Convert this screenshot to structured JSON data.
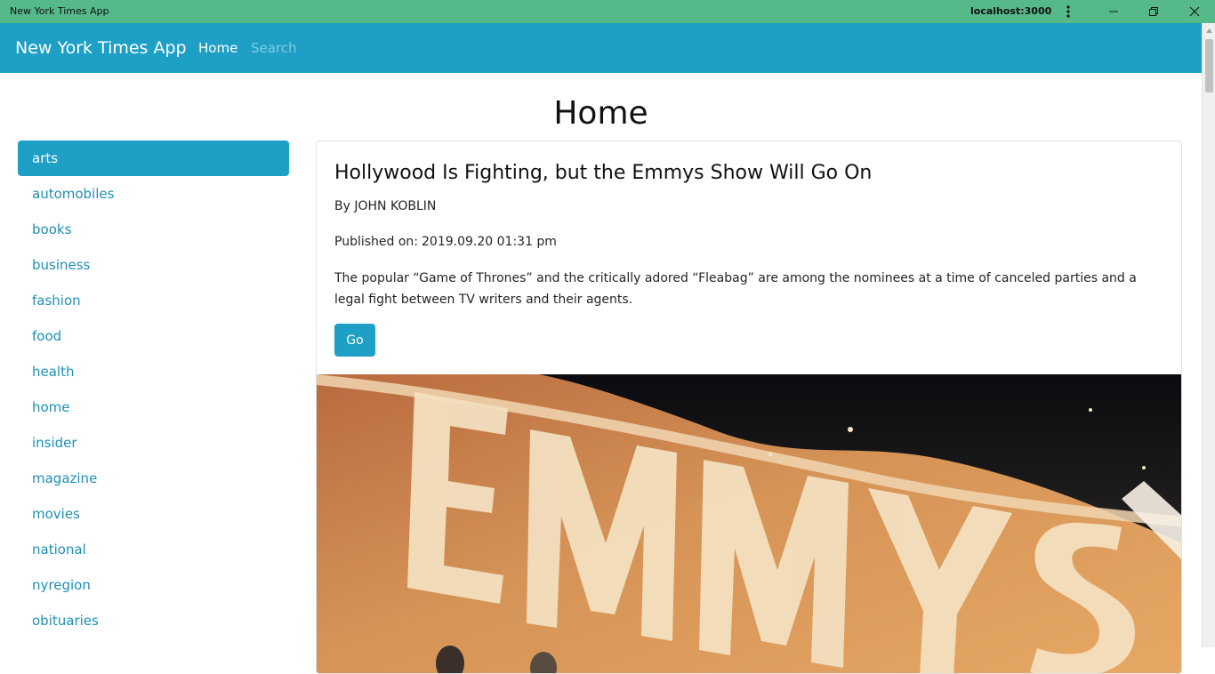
{
  "window": {
    "title": "New York Times App",
    "url": "localhost:3000",
    "controls": [
      "minimize",
      "restore",
      "close"
    ]
  },
  "navbar": {
    "brand": "New York Times App",
    "links": [
      {
        "label": "Home",
        "active": true
      },
      {
        "label": "Search",
        "active": false
      }
    ]
  },
  "page": {
    "title": "Home"
  },
  "sidebar": {
    "items": [
      {
        "label": "arts",
        "active": true
      },
      {
        "label": "automobiles",
        "active": false
      },
      {
        "label": "books",
        "active": false
      },
      {
        "label": "business",
        "active": false
      },
      {
        "label": "fashion",
        "active": false
      },
      {
        "label": "food",
        "active": false
      },
      {
        "label": "health",
        "active": false
      },
      {
        "label": "home",
        "active": false
      },
      {
        "label": "insider",
        "active": false
      },
      {
        "label": "magazine",
        "active": false
      },
      {
        "label": "movies",
        "active": false
      },
      {
        "label": "national",
        "active": false
      },
      {
        "label": "nyregion",
        "active": false
      },
      {
        "label": "obituaries",
        "active": false
      }
    ]
  },
  "article": {
    "headline": "Hollywood Is Fighting, but the Emmys Show Will Go On",
    "byline": "By JOHN KOBLIN",
    "published_label": "Published on:",
    "published_value": "2019.09.20 01:31 pm",
    "abstract": "The popular “Game of Thrones” and the critically adored “Fleabag” are among the nominees at a time of canceled parties and a legal fight between TV writers and their agents.",
    "go_label": "Go",
    "image_letters": "EMMYS"
  },
  "colors": {
    "titlebar": "#55b98a",
    "primary": "#1d9fc6",
    "link": "#1e8fb7"
  }
}
